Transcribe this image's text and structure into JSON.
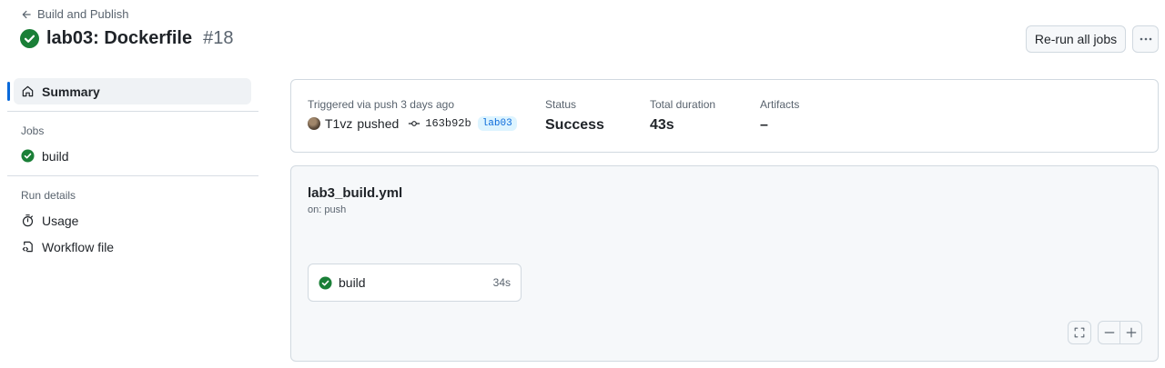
{
  "header": {
    "back_label": "Build and Publish",
    "title": "lab03: Dockerfile",
    "run_number": "#18"
  },
  "actions": {
    "rerun_label": "Re-run all jobs"
  },
  "sidebar": {
    "summary_label": "Summary",
    "jobs_heading": "Jobs",
    "jobs": [
      {
        "label": "build",
        "status": "success"
      }
    ],
    "run_details_heading": "Run details",
    "details": [
      {
        "label": "Usage",
        "icon": "stopwatch-icon"
      },
      {
        "label": "Workflow file",
        "icon": "file-code-icon"
      }
    ]
  },
  "summary": {
    "trigger_label": "Triggered via push 3 days ago",
    "actor": "T1vz",
    "actor_action": "pushed",
    "commit_sha": "163b92b",
    "branch": "lab03",
    "status_label": "Status",
    "status_value": "Success",
    "duration_label": "Total duration",
    "duration_value": "43s",
    "artifacts_label": "Artifacts",
    "artifacts_value": "–"
  },
  "workflow": {
    "file_name": "lab3_build.yml",
    "trigger": "on: push",
    "job": {
      "name": "build",
      "duration": "34s",
      "status": "success"
    }
  },
  "colors": {
    "success": "#1a7f37",
    "accent": "#0969da",
    "border": "#d1d9e0",
    "muted": "#59636e"
  }
}
